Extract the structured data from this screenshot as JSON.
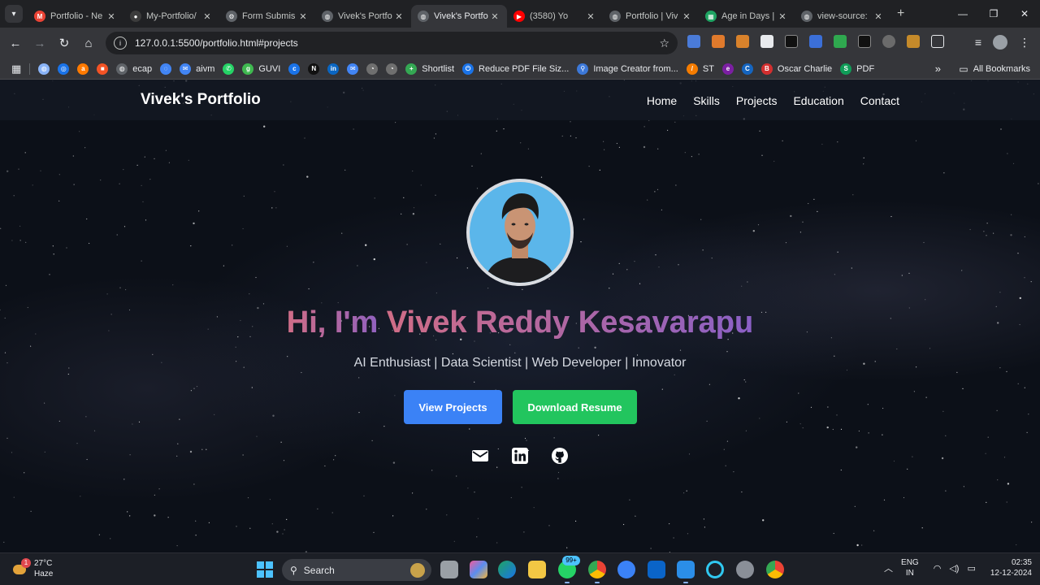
{
  "browser": {
    "tabs": [
      {
        "title": "Portfolio - Ne",
        "favicon": "gmail-icon",
        "color": "#ea4335",
        "glyph": "M",
        "active": false
      },
      {
        "title": "My-Portfolio/",
        "favicon": "github-icon",
        "color": "#3c3c3c",
        "glyph": "●",
        "active": false
      },
      {
        "title": "Form Submis",
        "favicon": "settings-icon",
        "color": "#5f6368",
        "glyph": "⚙",
        "active": false
      },
      {
        "title": "Vivek's Portfo",
        "favicon": "globe-icon",
        "color": "#5f6368",
        "glyph": "◍",
        "active": false
      },
      {
        "title": "Vivek's Portfo",
        "favicon": "globe-icon",
        "color": "#5f6368",
        "glyph": "◍",
        "active": true
      },
      {
        "title": "(3580) Yo",
        "favicon": "youtube-icon",
        "color": "#ff0000",
        "glyph": "▶",
        "active": false
      },
      {
        "title": "Portfolio | Viv",
        "favicon": "globe-icon",
        "color": "#5f6368",
        "glyph": "◍",
        "active": false
      },
      {
        "title": "Age in Days |",
        "favicon": "sheets-icon",
        "color": "#1fa463",
        "glyph": "▦",
        "active": false
      },
      {
        "title": "view-source:",
        "favicon": "globe-icon",
        "color": "#5f6368",
        "glyph": "◍",
        "active": false
      }
    ],
    "url": "127.0.0.1:5500/portfolio.html#projects",
    "bookmarks": [
      {
        "label": "",
        "color": "#8ab4f8",
        "glyph": "◍"
      },
      {
        "label": "",
        "color": "#1a73e8",
        "glyph": "◎"
      },
      {
        "label": "",
        "color": "#ff7a00",
        "glyph": "a"
      },
      {
        "label": "",
        "color": "#f35325",
        "glyph": "■"
      },
      {
        "label": "ecap",
        "color": "#5f6368",
        "glyph": "◍"
      },
      {
        "label": "",
        "color": "#4285f4",
        "glyph": "◌"
      },
      {
        "label": "aivm",
        "color": "#4285f4",
        "glyph": "✉"
      },
      {
        "label": "",
        "color": "#25d366",
        "glyph": "✆"
      },
      {
        "label": "GUVI",
        "color": "#3fb950",
        "glyph": "g"
      },
      {
        "label": "",
        "color": "#1a73e8",
        "glyph": "c"
      },
      {
        "label": "",
        "color": "#111111",
        "glyph": "N"
      },
      {
        "label": "",
        "color": "#0a66c2",
        "glyph": "in"
      },
      {
        "label": "",
        "color": "#4285f4",
        "glyph": "✉"
      },
      {
        "label": "",
        "color": "#6f6f6f",
        "glyph": "◔"
      },
      {
        "label": "",
        "color": "#6f6f6f",
        "glyph": "◔"
      },
      {
        "label": "Shortlist",
        "color": "#34a853",
        "glyph": "+"
      },
      {
        "label": "Reduce PDF File Siz...",
        "color": "#1a73e8",
        "glyph": "⏻"
      },
      {
        "label": "Image Creator from...",
        "color": "#3c78d8",
        "glyph": "⚲"
      },
      {
        "label": "ST",
        "color": "#f57c00",
        "glyph": "/"
      },
      {
        "label": "",
        "color": "#7b1fa2",
        "glyph": "e"
      },
      {
        "label": "",
        "color": "#1565c0",
        "glyph": "C"
      },
      {
        "label": "Oscar Charlie",
        "color": "#d32f2f",
        "glyph": "B"
      },
      {
        "label": "PDF",
        "color": "#0f9d58",
        "glyph": "S"
      }
    ],
    "all_bookmarks_label": "All Bookmarks"
  },
  "site": {
    "brand": "Vivek's Portfolio",
    "nav": [
      "Home",
      "Skills",
      "Projects",
      "Education",
      "Contact"
    ],
    "hero": {
      "title_part1": "Hi, I'm ",
      "title_part2": "Vivek Reddy Kesavarapu",
      "subtitle": "AI Enthusiast | Data Scientist | Web Developer | Innovator",
      "primary_button": "View Projects",
      "secondary_button": "Download Resume"
    },
    "social": [
      "mail-icon",
      "linkedin-icon",
      "github-icon"
    ],
    "colors": {
      "primary": "#3b82f6",
      "secondary": "#22c55e",
      "avatar_bg": "#5bb6ea"
    }
  },
  "taskbar": {
    "weather_badge": "1",
    "temperature": "27°C",
    "condition": "Haze",
    "search_label": "Search",
    "whatsapp_badge": "99+",
    "lang_line1": "ENG",
    "lang_line2": "IN",
    "time": "02:35",
    "date": "12-12-2024"
  }
}
